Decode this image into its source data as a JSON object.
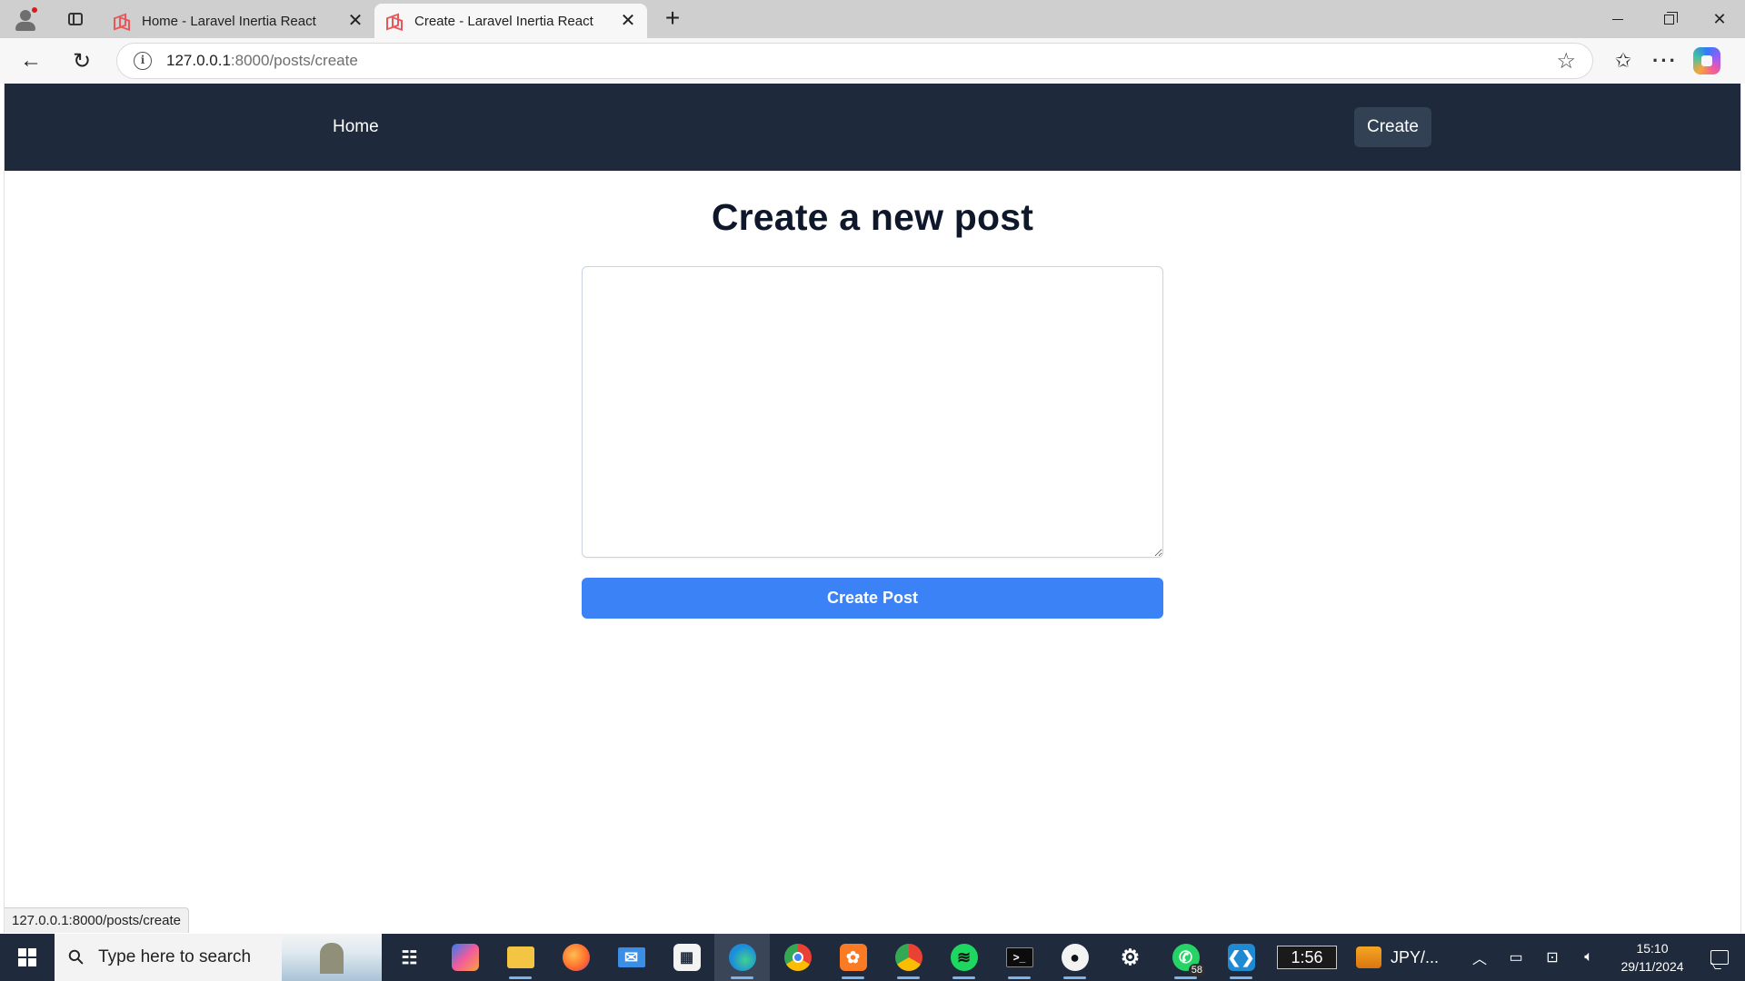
{
  "browser": {
    "tabs": [
      {
        "title": "Home - Laravel Inertia React",
        "active": false
      },
      {
        "title": "Create - Laravel Inertia React",
        "active": true
      }
    ],
    "address": {
      "host": "127.0.0.1",
      "path": ":8000/posts/create"
    },
    "status_url": "127.0.0.1:8000/posts/create"
  },
  "app": {
    "nav": {
      "home_label": "Home",
      "create_label": "Create"
    },
    "page_title": "Create a new post",
    "form": {
      "textarea_value": "",
      "submit_label": "Create Post"
    },
    "colors": {
      "navbar": "#1e293b",
      "create_bg": "#334155",
      "button": "#3b82f6"
    }
  },
  "taskbar": {
    "search_placeholder": "Type here to search",
    "pill_text": "1:56",
    "whatsapp_badge": "58",
    "ticker_label": "JPY/...",
    "time": "15:10",
    "date": "29/11/2024",
    "icons": [
      "task-view-icon",
      "copilot-icon",
      "file-explorer-icon",
      "firefox-icon",
      "mail-icon",
      "store-icon",
      "edge-icon",
      "chrome-icon",
      "xampp-icon",
      "chrome-profile-icon",
      "spotify-icon",
      "terminal-icon",
      "github-desktop-icon",
      "settings-icon",
      "whatsapp-icon",
      "vscode-icon"
    ]
  }
}
